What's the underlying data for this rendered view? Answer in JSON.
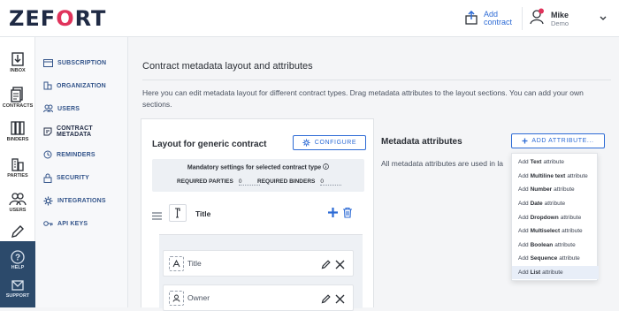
{
  "header": {
    "logo": "ZEFORT",
    "add_contract_line1": "Add",
    "add_contract_line2": "contract",
    "user_name": "Mike",
    "user_sub": "Demo"
  },
  "rail": {
    "items": [
      {
        "label": "INBOX",
        "icon": "inbox-icon"
      },
      {
        "label": "CONTRACTS",
        "icon": "contracts-icon"
      },
      {
        "label": "BINDERS",
        "icon": "binders-icon"
      },
      {
        "label": "PARTIES",
        "icon": "parties-icon"
      },
      {
        "label": "USERS",
        "icon": "users-icon"
      },
      {
        "label": "",
        "icon": "settings-pen-icon"
      },
      {
        "label": "HELP",
        "icon": "help-icon"
      },
      {
        "label": "SUPPORT",
        "icon": "support-icon"
      }
    ]
  },
  "subnav": {
    "items": [
      {
        "label": "SUBSCRIPTION",
        "icon": "subscription-icon"
      },
      {
        "label": "ORGANIZATION",
        "icon": "organization-icon"
      },
      {
        "label": "USERS",
        "icon": "users-icon"
      },
      {
        "label": "CONTRACT METADATA",
        "icon": "metadata-icon",
        "active": true
      },
      {
        "label": "REMINDERS",
        "icon": "reminders-icon"
      },
      {
        "label": "SECURITY",
        "icon": "lock-icon"
      },
      {
        "label": "INTEGRATIONS",
        "icon": "integrations-icon"
      },
      {
        "label": "API KEYS",
        "icon": "key-icon"
      }
    ]
  },
  "main": {
    "title": "Contract metadata layout and attributes",
    "description": "Here you can edit metadata layout for different contract types. Drag metadata attributes to the layout sections. You can add your own sections.",
    "layout": {
      "title": "Layout for generic contract",
      "configure_label": "CONFIGURE",
      "mandatory_title": "Mandatory settings for selected contract type",
      "required_parties_label": "REQUIRED PARTIES",
      "required_parties_value": "0",
      "required_binders_label": "REQUIRED BINDERS",
      "required_binders_value": "0",
      "section_title": "Title",
      "attributes": [
        "Title",
        "Owner"
      ]
    },
    "metadata": {
      "title": "Metadata attributes",
      "add_label": "ADD ATTRIBUTE...",
      "note": "All metadata attributes are used in la"
    },
    "dropdown": {
      "items": [
        {
          "pre": "Add",
          "type": "Text",
          "post": "attribute"
        },
        {
          "pre": "Add",
          "type": "Multiline text",
          "post": "attribute"
        },
        {
          "pre": "Add",
          "type": "Number",
          "post": "attribute"
        },
        {
          "pre": "Add",
          "type": "Date",
          "post": "attribute"
        },
        {
          "pre": "Add",
          "type": "Dropdown",
          "post": "attribute"
        },
        {
          "pre": "Add",
          "type": "Multiselect",
          "post": "attribute"
        },
        {
          "pre": "Add",
          "type": "Boolean",
          "post": "attribute"
        },
        {
          "pre": "Add",
          "type": "Sequence",
          "post": "attribute"
        },
        {
          "pre": "Add",
          "type": "List",
          "post": "attribute"
        }
      ]
    }
  },
  "colors": {
    "accent": "#2d6bd5",
    "logo_accent": "#e0335b",
    "rail_bottom": "#2c4a6b"
  }
}
